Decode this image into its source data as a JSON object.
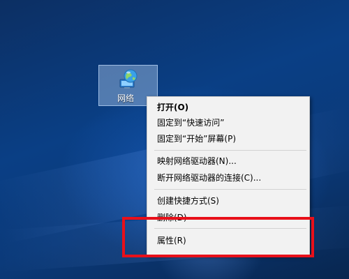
{
  "desktop": {
    "icon": {
      "label": "网络",
      "icon_name": "network-globe-icon"
    }
  },
  "context_menu": {
    "items": [
      {
        "label": "打开(O)",
        "bold": true
      },
      {
        "label": "固定到“快速访问”"
      },
      {
        "label": "固定到“开始”屏幕(P)"
      },
      {
        "label": "映射网络驱动器(N)..."
      },
      {
        "label": "断开网络驱动器的连接(C)..."
      },
      {
        "label": "创建快捷方式(S)"
      },
      {
        "label": "删除(D)"
      },
      {
        "label": "属性(R)"
      }
    ]
  },
  "colors": {
    "highlight": "#e8101a",
    "menu_background": "#f2f2f2"
  }
}
